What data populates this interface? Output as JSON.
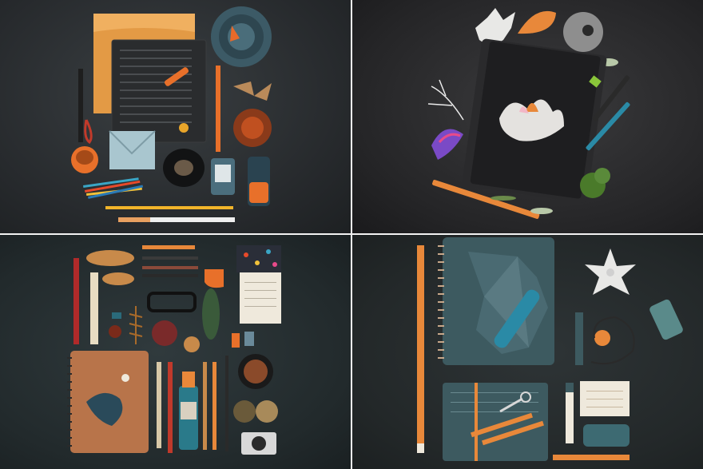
{
  "image": {
    "layout": "2x2 grid",
    "panels": [
      {
        "name": "orange-stationery-flatlay",
        "accent": "#e8832a"
      },
      {
        "name": "black-notebook-paper-flowers",
        "accent": "#d95f2b"
      },
      {
        "name": "brown-notebook-collection",
        "accent": "#b8744a"
      },
      {
        "name": "teal-notebook-origami",
        "accent": "#3d5a60"
      }
    ],
    "colors": {
      "background_dark": "#24282a",
      "orange": "#e8832a",
      "teal": "#3d5a60",
      "paper": "#efe9dc",
      "divider": "#f2f2f2"
    }
  }
}
